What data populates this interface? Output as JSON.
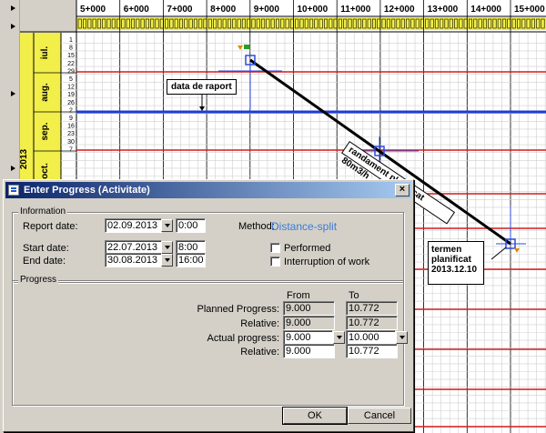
{
  "gantt": {
    "year_label": "2013",
    "months": [
      "iul.",
      "aug.",
      "sep.",
      "oct."
    ],
    "days": [
      "1",
      "8",
      "15",
      "22",
      "29",
      "5",
      "12",
      "19",
      "26",
      "2",
      "9",
      "16",
      "23",
      "30",
      "7"
    ],
    "chainages": [
      "5+000",
      "6+000",
      "7+000",
      "8+000",
      "9+000",
      "10+000",
      "11+000",
      "12+000",
      "13+000",
      "14+000",
      "15+000"
    ],
    "annotations": {
      "report_date_label": "data de raport",
      "planned_output_label": "randament planificat 80m3/h",
      "deadline_line1": "termen",
      "deadline_line2": "planificat",
      "deadline_line3": "2013.12.10"
    },
    "colors": {
      "report_line": "#1f3bd8",
      "month_band": "#f2ee4a",
      "red_line": "#d21c1c",
      "blue_line": "#2d4be0"
    }
  },
  "dialog": {
    "title": "Enter Progress (Activitate)",
    "close_icon": "close-icon",
    "information": {
      "group_title": "Information",
      "report_date_label": "Report date:",
      "report_date": "02.09.2013",
      "report_time": "0:00",
      "method_label": "Method:",
      "method_value": "Distance-split",
      "start_date_label": "Start date:",
      "start_date": "22.07.2013",
      "start_time": "8:00",
      "end_date_label": "End date:",
      "end_date": "30.08.2013",
      "end_time": "16:00",
      "performed_label": "Performed",
      "interruption_label": "Interruption of work"
    },
    "progress": {
      "group_title": "Progress",
      "from_header": "From",
      "to_header": "To",
      "planned_label": "Planned Progress:",
      "planned_from": "9.000",
      "planned_to": "10.772",
      "relative_label_1": "Relative:",
      "relative_planned_from": "9.000",
      "relative_planned_to": "10.772",
      "actual_label": "Actual progress:",
      "actual_from": "9.000",
      "actual_to": "10.000",
      "relative_label_2": "Relative:",
      "relative_actual_from": "9.000",
      "relative_actual_to": "10.772"
    },
    "ok_label": "OK",
    "cancel_label": "Cancel"
  }
}
